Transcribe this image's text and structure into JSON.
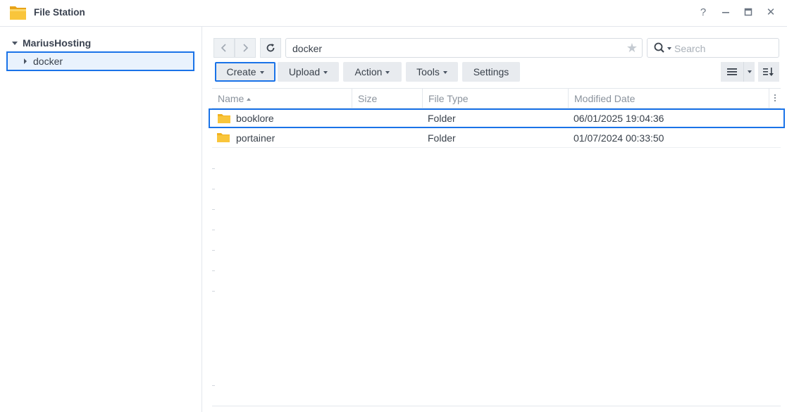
{
  "window": {
    "title": "File Station",
    "help_label": "?",
    "close_label": "✕"
  },
  "sidebar": {
    "root_label": "MariusHosting",
    "items": [
      {
        "label": "docker"
      }
    ]
  },
  "toolbar": {
    "path": "docker",
    "search_placeholder": "Search",
    "create_label": "Create",
    "upload_label": "Upload",
    "action_label": "Action",
    "tools_label": "Tools",
    "settings_label": "Settings"
  },
  "table": {
    "headers": {
      "name": "Name",
      "size": "Size",
      "file_type": "File Type",
      "modified": "Modified Date"
    },
    "rows": [
      {
        "name": "booklore",
        "size": "",
        "type": "Folder",
        "modified": "06/01/2025 19:04:36"
      },
      {
        "name": "portainer",
        "size": "",
        "type": "Folder",
        "modified": "01/07/2024 00:33:50"
      }
    ]
  },
  "colors": {
    "accent": "#1a73e8",
    "folder": "#f9c53b"
  },
  "icons": [
    "file-station-icon",
    "help-icon",
    "minimize-icon",
    "maximize-icon",
    "close-icon",
    "back-icon",
    "forward-icon",
    "refresh-icon",
    "star-icon",
    "search-icon",
    "list-view-icon",
    "sort-icon",
    "folder-icon"
  ]
}
